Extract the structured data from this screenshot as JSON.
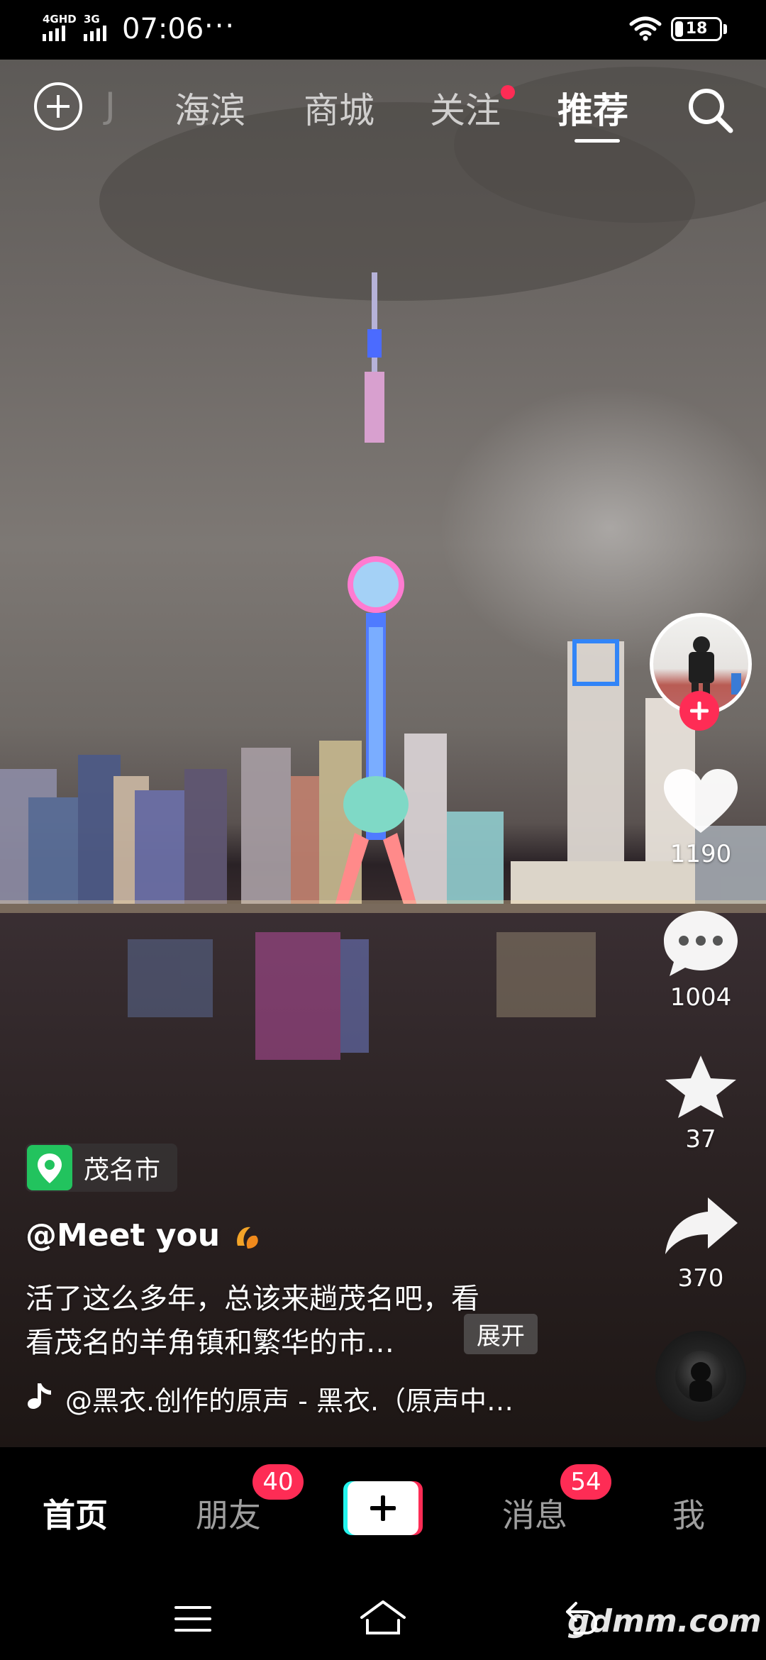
{
  "status_bar": {
    "network_left": "4GHD",
    "network_right": "3G",
    "time": "07:06",
    "more": "···",
    "battery": "18",
    "battery_level": 0.18
  },
  "top_tabs": {
    "ghost_label": "J",
    "items": [
      {
        "label": "海滨"
      },
      {
        "label": "商城"
      },
      {
        "label": "关注"
      },
      {
        "label": "推荐"
      }
    ],
    "active_index": 3
  },
  "actions": {
    "likes": "1190",
    "comments": "1004",
    "favorites": "37",
    "shares": "370"
  },
  "post": {
    "location": "茂名市",
    "author": "@Meet you",
    "description_line1": "活了这么多年，总该来趟茂名吧，看",
    "description_line2": "看茂名的羊角镇和繁华的市…",
    "expand_label": "展开",
    "music": "@黑衣.创作的原声 - 黑衣.（原声中…"
  },
  "bottom_nav": {
    "home": "首页",
    "friends": "朋友",
    "friends_badge": "40",
    "messages": "消息",
    "messages_badge": "54",
    "me": "我"
  },
  "watermark": "gdmm.com",
  "colors": {
    "accent": "#fe2c55",
    "cyan": "#25f4ee",
    "location_green": "#22c35e"
  }
}
